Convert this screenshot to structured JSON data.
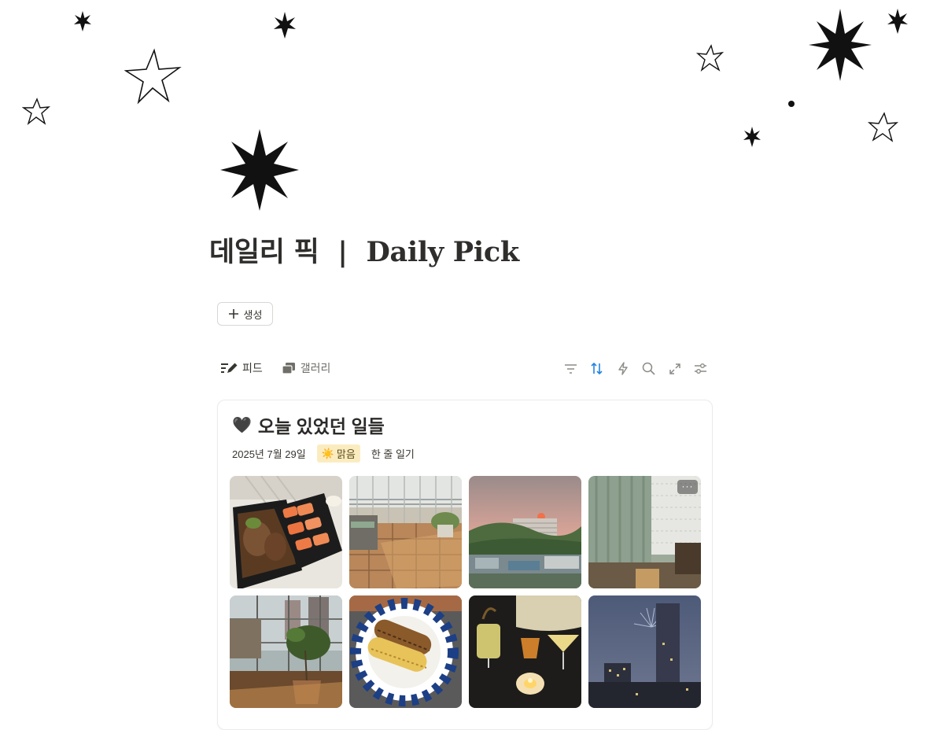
{
  "page": {
    "title": "데일리 픽  |  Daily Pick",
    "page_icon": "eight-point-star-icon"
  },
  "toolbar": {
    "create_label": "생성",
    "views": [
      {
        "label": "피드",
        "icon": "feed-edit-icon",
        "active": true
      },
      {
        "label": "갤러리",
        "icon": "gallery-cards-icon",
        "active": false
      }
    ],
    "tools": [
      "filter-icon",
      "sort-icon",
      "automation-bolt-icon",
      "search-icon",
      "expand-icon",
      "settings-sliders-icon"
    ],
    "accent_color": "#2383e2"
  },
  "entry": {
    "emoji": "🖤",
    "title": "오늘 있었던 일들",
    "date": "2025년 7월 29일",
    "weather_icon": "☀️",
    "weather": "맑음",
    "one_line": "한 줄 일기",
    "more_label": "···",
    "photos": [
      {
        "name": "photo-grilled-meat-and-salmon"
      },
      {
        "name": "photo-balcony-floor"
      },
      {
        "name": "photo-sunset-city"
      },
      {
        "name": "photo-curtain-window"
      },
      {
        "name": "photo-plant-by-window"
      },
      {
        "name": "photo-grilled-corn-plate"
      },
      {
        "name": "photo-cocktails-candle"
      },
      {
        "name": "photo-night-fireworks"
      }
    ]
  }
}
